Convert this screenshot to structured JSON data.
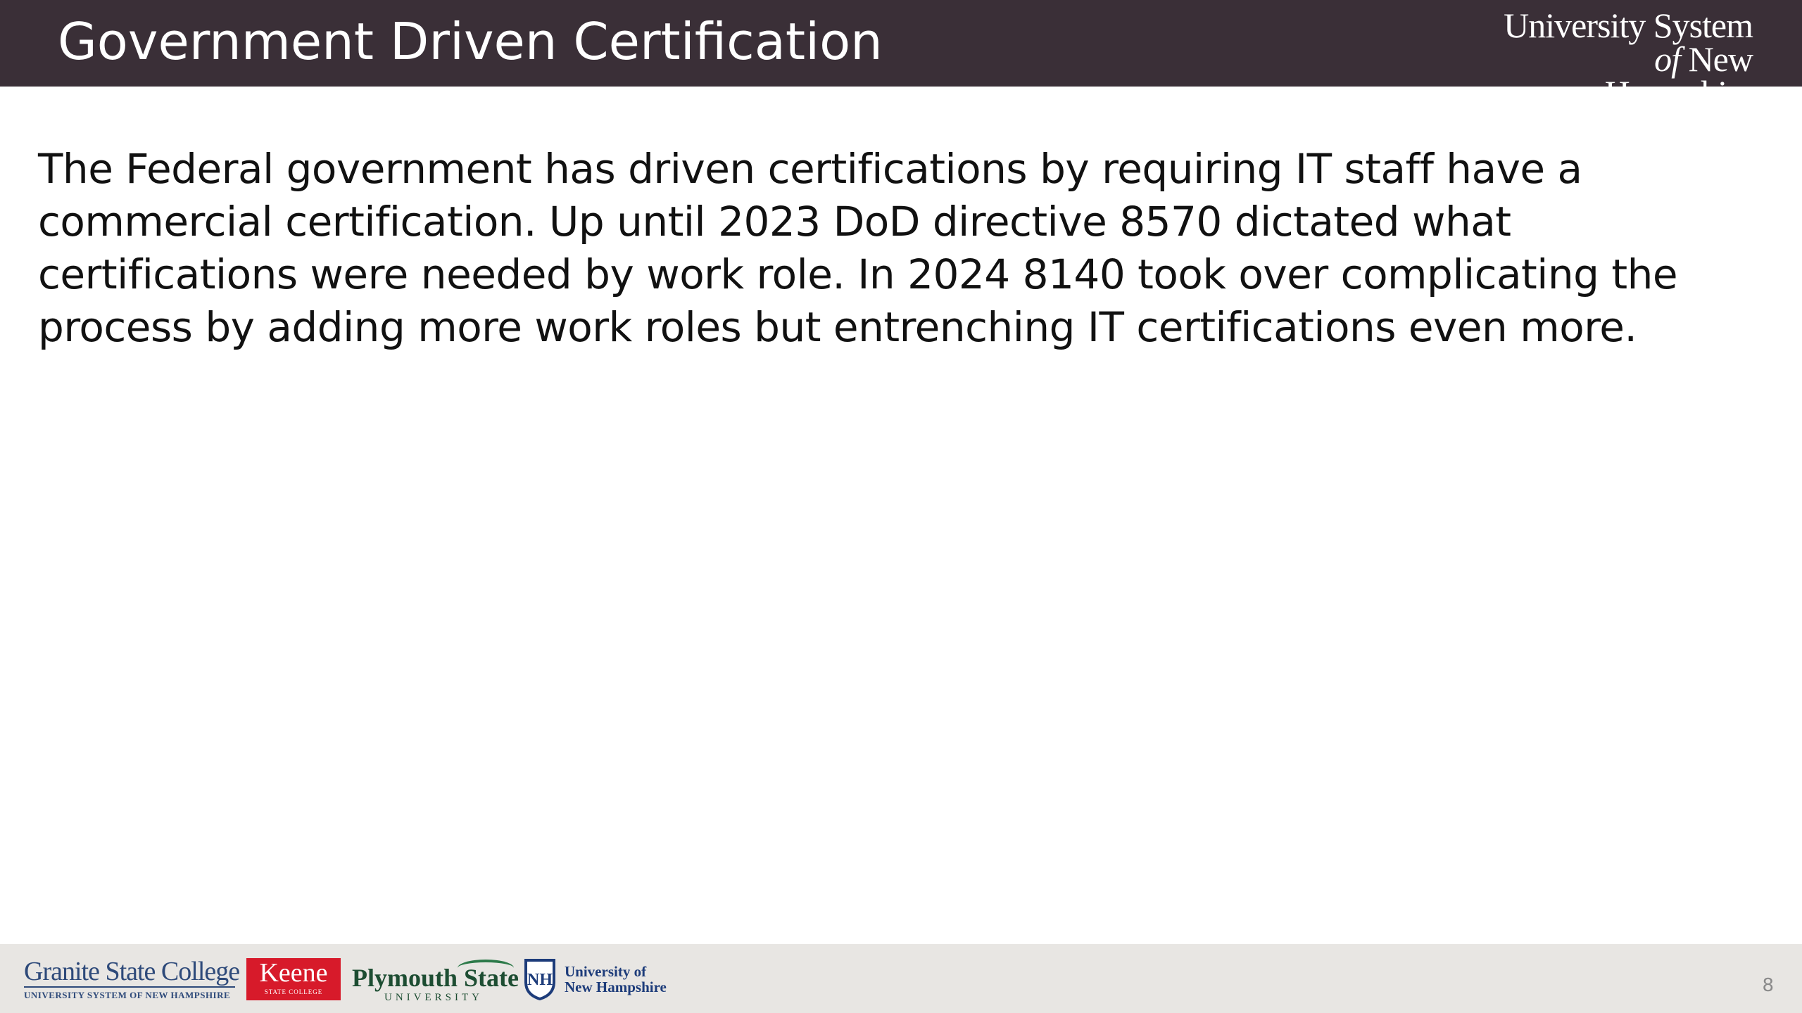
{
  "header": {
    "title": "Government Driven Certification",
    "logo_line1": "University System",
    "logo_of": "of",
    "logo_line2": "New Hampshire"
  },
  "body": {
    "paragraph": "The Federal government has driven certifications by requiring IT staff have a commercial certification. Up until 2023 DoD directive 8570 dictated what certifications were needed by work role. In 2024 8140 took over complicating the process by adding more work roles but entrenching IT certifications even more."
  },
  "footer": {
    "logos": {
      "gsc_main": "Granite State College",
      "gsc_sub": "UNIVERSITY SYSTEM OF NEW HAMPSHIRE",
      "keene_main": "Keene",
      "keene_sub": "STATE COLLEGE",
      "psu_main": "Plymouth State",
      "psu_sub": "UNIVERSITY",
      "unh_line1": "University of",
      "unh_line2": "New Hampshire",
      "unh_shield": "NH"
    },
    "page_number": "8"
  },
  "colors": {
    "header_bg": "#3a2f37",
    "footer_bg": "#e8e6e3",
    "keene_red": "#d71a2a",
    "gsc_blue": "#2e4a7a",
    "psu_green": "#1d4d32",
    "unh_blue": "#1d3c7a"
  }
}
